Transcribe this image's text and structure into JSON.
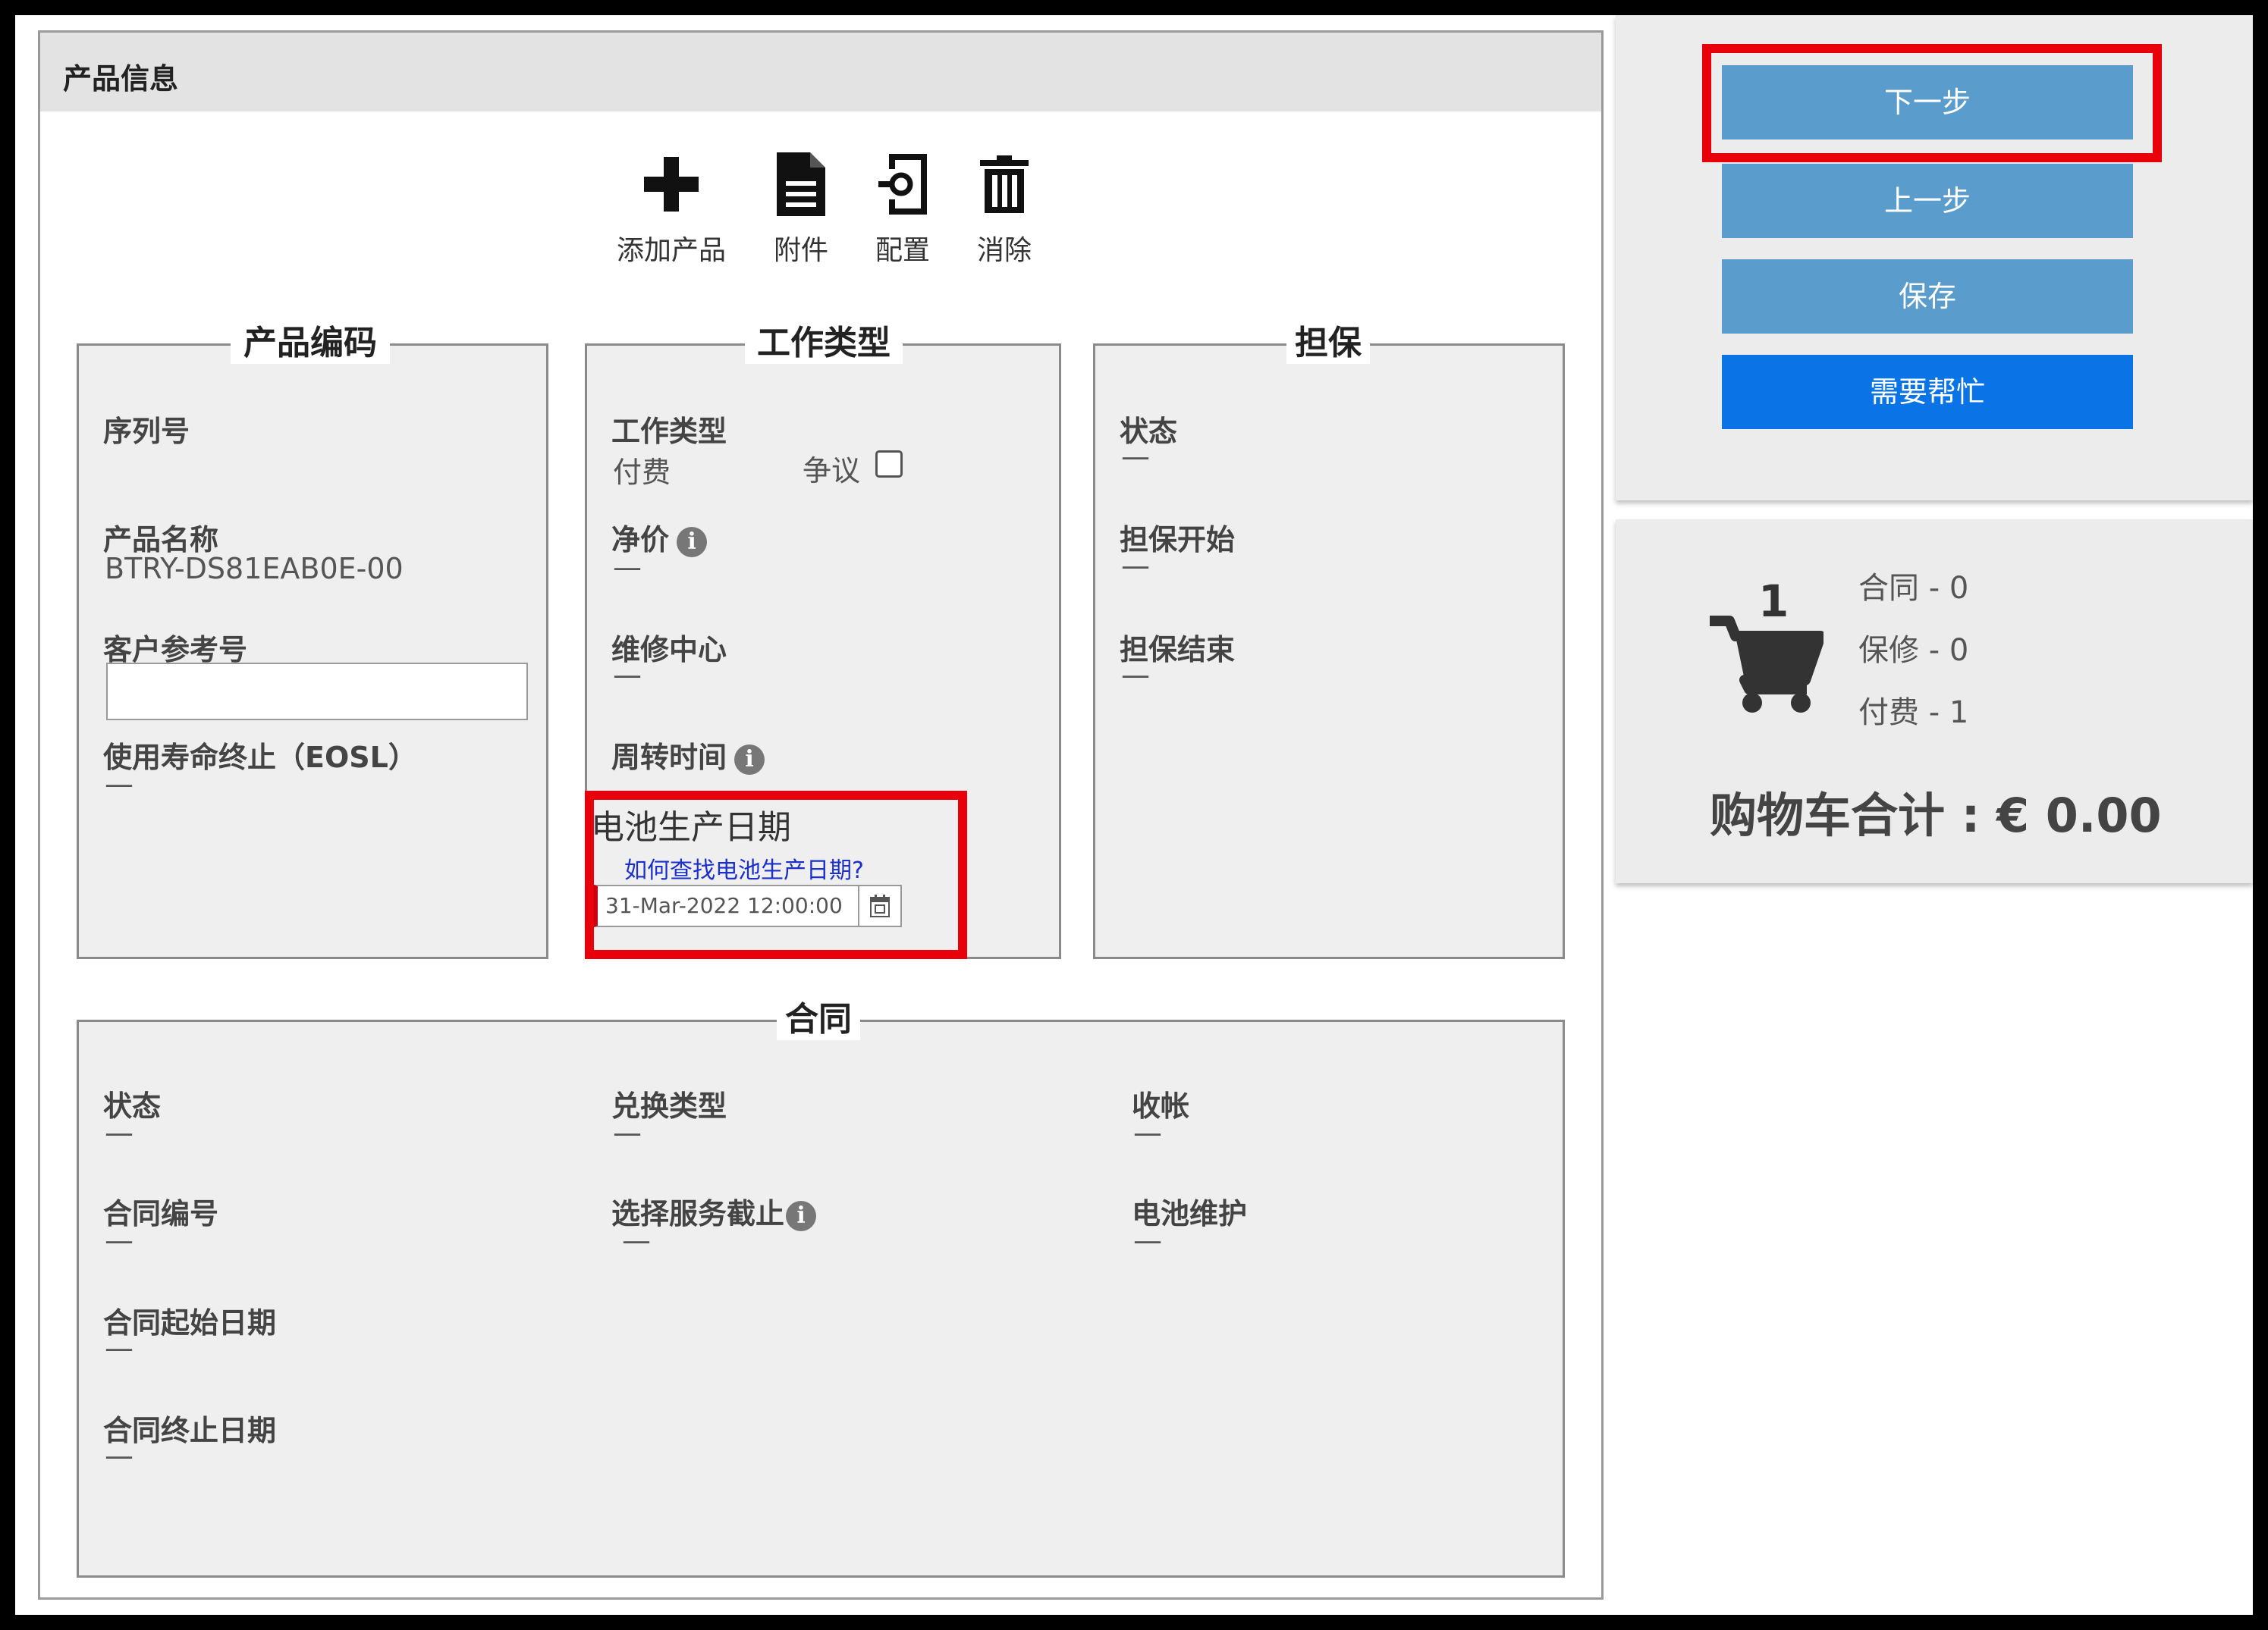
{
  "product_info": {
    "title": "产品信息",
    "toolbar": {
      "add_label": "添加产品",
      "attachment_label": "附件",
      "config_label": "配置",
      "delete_label": "消除"
    },
    "product_code": {
      "title": "产品编码",
      "serial_label": "序列号",
      "name_label": "产品名称",
      "name_value": "BTRY-DS81EAB0E-00",
      "cust_ref_label": "客户参考号",
      "cust_ref_value": "",
      "eosl_label": "使用寿命终止（EOSL）",
      "eosl_value": "—"
    },
    "work_type": {
      "title": "工作类型",
      "work_type_label": "工作类型",
      "work_type_value": "付费",
      "dispute_label": "争议",
      "net_price_label": "净价",
      "net_price_value": "—",
      "repair_center_label": "维修中心",
      "repair_center_value": "—",
      "turnaround_label": "周转时间",
      "battery_date_label": "电池生产日期",
      "battery_date_link": "如何查找电池生产日期?",
      "battery_date_value": "31-Mar-2022 12:00:00"
    },
    "warranty": {
      "title": "担保",
      "status_label": "状态",
      "status_value": "—",
      "start_label": "担保开始",
      "start_value": "—",
      "end_label": "担保结束",
      "end_value": "—"
    },
    "contract": {
      "title": "合同",
      "status_label": "状态",
      "status_value": "—",
      "exchange_label": "兑换类型",
      "exchange_value": "—",
      "billing_label": "收帐",
      "billing_value": "—",
      "number_label": "合同编号",
      "number_value": "—",
      "service_cutoff_label": "选择服务截止",
      "service_cutoff_value": "—",
      "battery_maint_label": "电池维护",
      "battery_maint_value": "—",
      "start_label": "合同起始日期",
      "start_value": "—",
      "end_label": "合同终止日期",
      "end_value": "—"
    }
  },
  "actions": {
    "next_label": "下一步",
    "prev_label": "上一步",
    "save_label": "保存",
    "help_label": "需要帮忙"
  },
  "cart": {
    "count": "1",
    "contract_line": "合同 - 0",
    "warranty_line": "保修 - 0",
    "paid_line": "付费 - 1",
    "total": "购物车合计 : € 0.00"
  },
  "colors": {
    "highlight": "#e8000b",
    "button_steel": "#5a9dcd",
    "button_help": "#0a74e6"
  }
}
